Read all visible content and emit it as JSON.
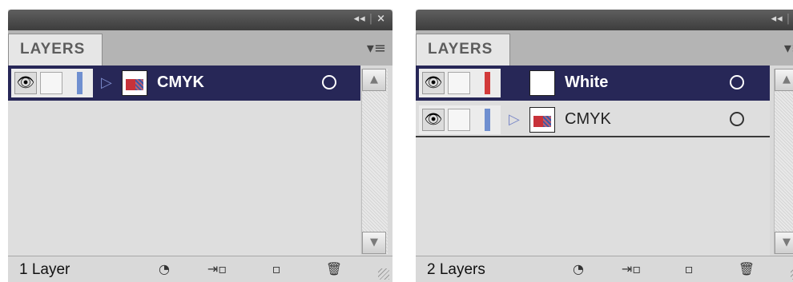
{
  "panels": [
    {
      "title_controls": {
        "collapse": "◂◂",
        "close": "×"
      },
      "tab": {
        "label": "LAYERS"
      },
      "menu_icon": "panel-menu-icon",
      "layers": [
        {
          "name": "CMYK",
          "selected": true,
          "color": "#6f8fd0",
          "has_disclosure": true,
          "thumb": "art"
        }
      ],
      "count": "1 Layer"
    },
    {
      "title_controls": {
        "collapse": "◂◂",
        "close": "×"
      },
      "tab": {
        "label": "LAYERS"
      },
      "menu_icon": "panel-menu-icon",
      "layers": [
        {
          "name": "White",
          "selected": true,
          "color": "#d23a3a",
          "has_disclosure": false,
          "thumb": "blank"
        },
        {
          "name": "CMYK",
          "selected": false,
          "color": "#6f8fd0",
          "has_disclosure": true,
          "thumb": "art"
        }
      ],
      "count": "2 Layers"
    }
  ],
  "footer_icons": [
    "make-clip-mask-icon",
    "new-sublayer-icon",
    "new-layer-icon",
    "trash-icon"
  ],
  "colors": {
    "selection": "#272757",
    "panel_bg": "#d9d9d9",
    "titlebar": "#4a4a4a"
  }
}
